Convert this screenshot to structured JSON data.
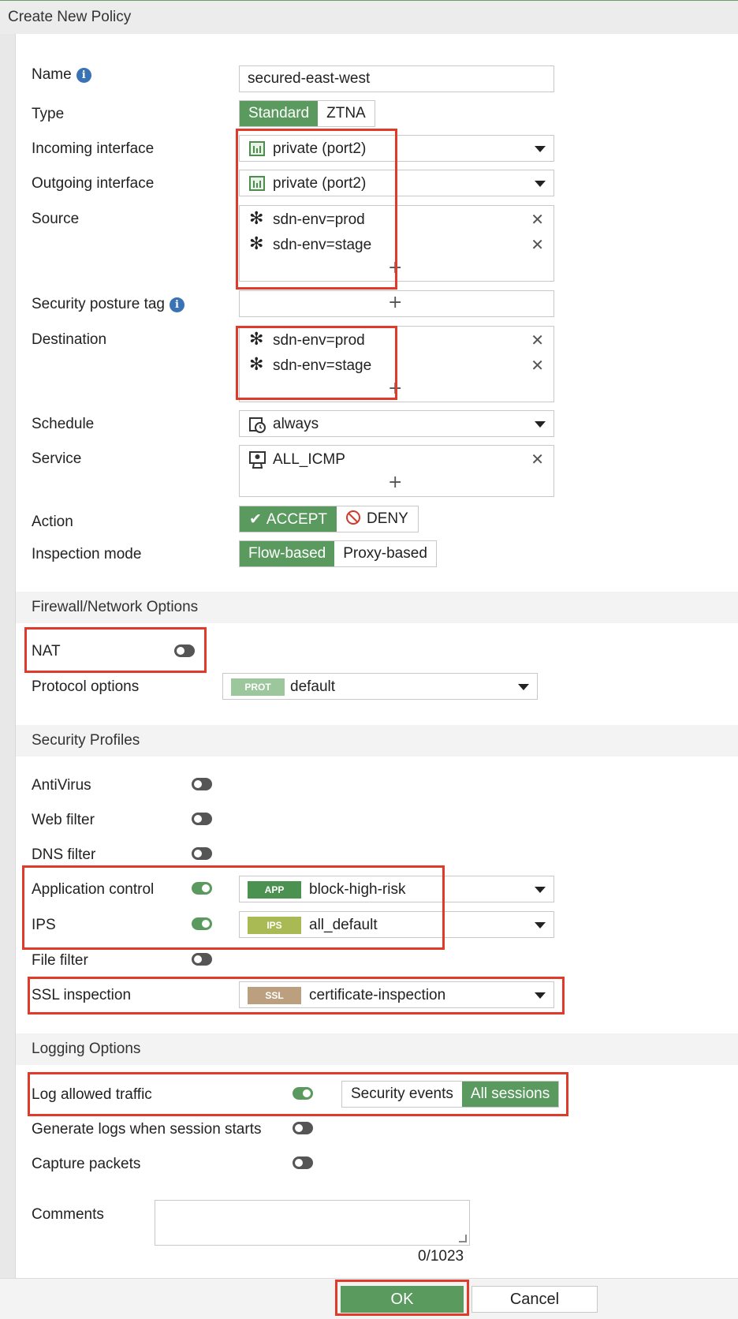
{
  "dialog": {
    "title": "Create New Policy"
  },
  "fields": {
    "name": {
      "label": "Name",
      "value": "secured-east-west"
    },
    "type": {
      "label": "Type",
      "options": [
        "Standard",
        "ZTNA"
      ],
      "selected": "Standard"
    },
    "incoming": {
      "label": "Incoming interface",
      "value": "private (port2)"
    },
    "outgoing": {
      "label": "Outgoing interface",
      "value": "private (port2)"
    },
    "source": {
      "label": "Source",
      "items": [
        "sdn-env=prod",
        "sdn-env=stage"
      ]
    },
    "posture": {
      "label": "Security posture tag"
    },
    "destination": {
      "label": "Destination",
      "items": [
        "sdn-env=prod",
        "sdn-env=stage"
      ]
    },
    "schedule": {
      "label": "Schedule",
      "value": "always"
    },
    "service": {
      "label": "Service",
      "items": [
        "ALL_ICMP"
      ]
    },
    "action": {
      "label": "Action",
      "accept": "ACCEPT",
      "deny": "DENY",
      "selected": "ACCEPT"
    },
    "inspection": {
      "label": "Inspection mode",
      "options": [
        "Flow-based",
        "Proxy-based"
      ],
      "selected": "Flow-based"
    }
  },
  "firewall": {
    "heading": "Firewall/Network Options",
    "nat": {
      "label": "NAT",
      "enabled": false
    },
    "protocol": {
      "label": "Protocol options",
      "badge": "PROT",
      "value": "default"
    }
  },
  "security": {
    "heading": "Security Profiles",
    "antivirus": {
      "label": "AntiVirus",
      "enabled": false
    },
    "webfilter": {
      "label": "Web filter",
      "enabled": false
    },
    "dnsfilter": {
      "label": "DNS filter",
      "enabled": false
    },
    "appcontrol": {
      "label": "Application control",
      "enabled": true,
      "badge": "APP",
      "value": "block-high-risk"
    },
    "ips": {
      "label": "IPS",
      "enabled": true,
      "badge": "IPS",
      "value": "all_default"
    },
    "filefilter": {
      "label": "File filter",
      "enabled": false
    },
    "ssl": {
      "label": "SSL inspection",
      "badge": "SSL",
      "value": "certificate-inspection"
    }
  },
  "logging": {
    "heading": "Logging Options",
    "allowed": {
      "label": "Log allowed traffic",
      "enabled": true,
      "options": [
        "Security events",
        "All sessions"
      ],
      "selected": "All sessions"
    },
    "session_start": {
      "label": "Generate logs when session starts",
      "enabled": false
    },
    "capture": {
      "label": "Capture packets",
      "enabled": false
    }
  },
  "comments": {
    "label": "Comments",
    "counter": "0/1023"
  },
  "buttons": {
    "ok": "OK",
    "cancel": "Cancel"
  },
  "colors": {
    "accent": "#5b9a5f",
    "highlight": "#e03a2a",
    "info": "#3a73b5",
    "app_badge": "#4b9150",
    "ips_badge": "#a9b954",
    "ssl_badge": "#bb9f7e",
    "prot_badge": "#9cc79d"
  }
}
